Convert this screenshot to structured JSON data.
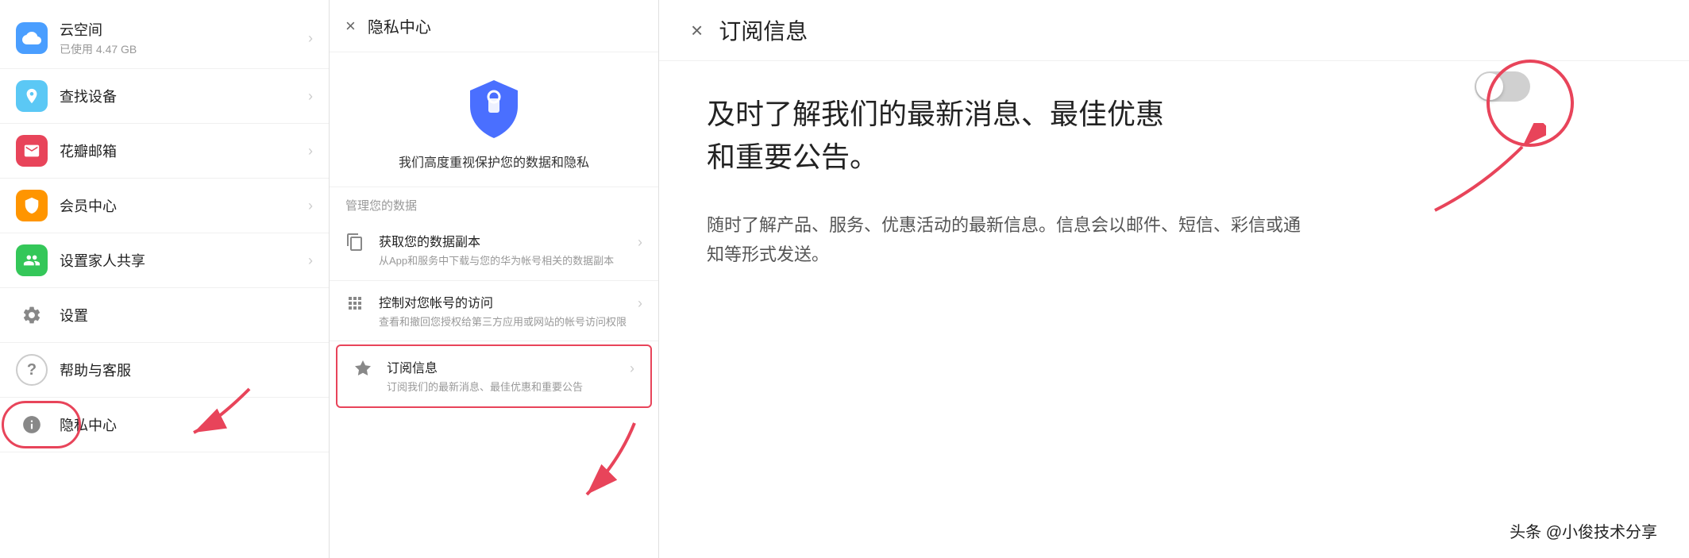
{
  "left_panel": {
    "items": [
      {
        "id": "cloud",
        "icon": "☁",
        "icon_class": "icon-cloud",
        "title": "云空间",
        "subtitle": "已使用 4.47 GB",
        "has_chevron": true
      },
      {
        "id": "find",
        "icon": "📍",
        "icon_class": "icon-find",
        "title": "查找设备",
        "subtitle": "",
        "has_chevron": true
      },
      {
        "id": "mail",
        "icon": "✉",
        "icon_class": "icon-mail",
        "title": "花瓣邮箱",
        "subtitle": "",
        "has_chevron": true
      },
      {
        "id": "vip",
        "icon": "♦",
        "icon_class": "icon-vip",
        "title": "会员中心",
        "subtitle": "",
        "has_chevron": true
      },
      {
        "id": "family",
        "icon": "👥",
        "icon_class": "icon-family",
        "title": "设置家人共享",
        "subtitle": "",
        "has_chevron": true
      },
      {
        "id": "settings",
        "icon": "⚙",
        "icon_class": "icon-settings",
        "title": "设置",
        "subtitle": "",
        "has_chevron": false
      },
      {
        "id": "help",
        "icon": "?",
        "icon_class": "icon-help",
        "title": "帮助与客服",
        "subtitle": "",
        "has_chevron": false
      },
      {
        "id": "privacy",
        "icon": "📋",
        "icon_class": "icon-privacy",
        "title": "隐私中心",
        "subtitle": "",
        "has_chevron": false
      }
    ]
  },
  "middle_panel": {
    "close_label": "×",
    "title": "隐私中心",
    "hero_text": "我们高度重视保护您的数据和隐私",
    "section_label": "管理您的数据",
    "menu_items": [
      {
        "id": "data-copy",
        "title": "获取您的数据副本",
        "desc": "从App和服务中下载与您的华为帐号相关的数据副本"
      },
      {
        "id": "access-control",
        "title": "控制对您帐号的访问",
        "desc": "查看和撤回您授权给第三方应用或网站的帐号访问权限"
      },
      {
        "id": "subscription",
        "title": "订阅信息",
        "desc": "订阅我们的最新消息、最佳优惠和重要公告",
        "highlighted": true
      }
    ]
  },
  "right_panel": {
    "close_label": "×",
    "title": "订阅信息",
    "main_text": "及时了解我们的最新消息、最佳优惠和重要公告。",
    "sub_text": "随时了解产品、服务、优惠活动的最新信息。信息会以邮件、短信、彩信或通知等形式发送。",
    "toggle_state": "off",
    "watermark": "头条 @小俊技术分享"
  },
  "icons": {
    "close": "×",
    "chevron": "›",
    "shield_color": "#4a6fff"
  }
}
